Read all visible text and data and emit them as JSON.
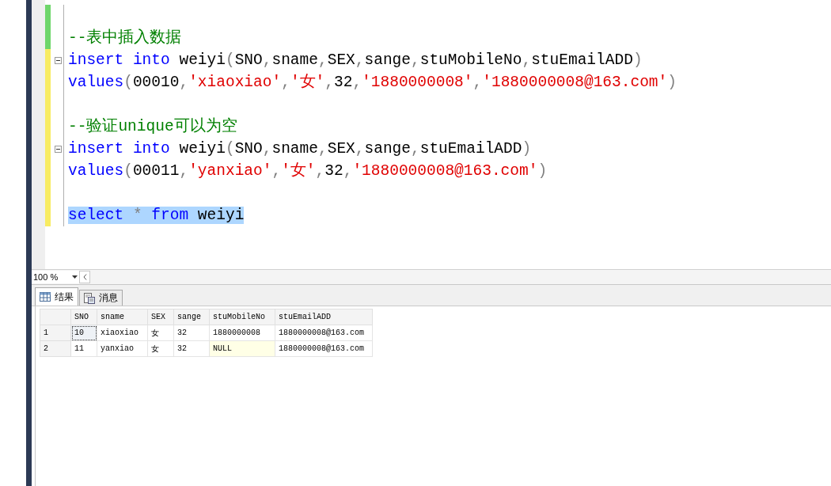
{
  "editor": {
    "lines": [
      {
        "saved": true,
        "fold": false
      },
      {
        "saved": true,
        "fold": false,
        "selected": false,
        "tokens": [
          {
            "kind": "comment",
            "text": "--表中插入数据"
          }
        ]
      },
      {
        "saved": false,
        "fold": true,
        "selected": false,
        "tokens": [
          {
            "kind": "keyword",
            "text": "insert"
          },
          {
            "kind": "keyword",
            "text": " into"
          },
          {
            "kind": "plain",
            "text": " weiyi"
          },
          {
            "kind": "punct",
            "text": "("
          },
          {
            "kind": "plain",
            "text": "SNO"
          },
          {
            "kind": "punct",
            "text": ","
          },
          {
            "kind": "plain",
            "text": "sname"
          },
          {
            "kind": "punct",
            "text": ","
          },
          {
            "kind": "plain",
            "text": "SEX"
          },
          {
            "kind": "punct",
            "text": ","
          },
          {
            "kind": "plain",
            "text": "sange"
          },
          {
            "kind": "punct",
            "text": ","
          },
          {
            "kind": "plain",
            "text": "stuMobileNo"
          },
          {
            "kind": "punct",
            "text": ","
          },
          {
            "kind": "plain",
            "text": "stuEmailADD"
          },
          {
            "kind": "punct",
            "text": ")"
          }
        ]
      },
      {
        "saved": false,
        "fold": false,
        "selected": false,
        "tokens": [
          {
            "kind": "keyword",
            "text": "values"
          },
          {
            "kind": "punct",
            "text": "("
          },
          {
            "kind": "plain",
            "text": "00010"
          },
          {
            "kind": "punct",
            "text": ","
          },
          {
            "kind": "string",
            "text": "'xiaoxiao'"
          },
          {
            "kind": "punct",
            "text": ","
          },
          {
            "kind": "string",
            "text": "'女'"
          },
          {
            "kind": "punct",
            "text": ","
          },
          {
            "kind": "plain",
            "text": "32"
          },
          {
            "kind": "punct",
            "text": ","
          },
          {
            "kind": "string",
            "text": "'1880000008'"
          },
          {
            "kind": "punct",
            "text": ","
          },
          {
            "kind": "string",
            "text": "'1880000008@163.com'"
          },
          {
            "kind": "punct",
            "text": ")"
          }
        ]
      },
      {
        "saved": false,
        "fold": false
      },
      {
        "saved": false,
        "fold": false,
        "selected": false,
        "tokens": [
          {
            "kind": "comment",
            "text": "--验证unique可以为空"
          }
        ]
      },
      {
        "saved": false,
        "fold": true,
        "selected": false,
        "tokens": [
          {
            "kind": "keyword",
            "text": "insert"
          },
          {
            "kind": "keyword",
            "text": " into"
          },
          {
            "kind": "plain",
            "text": " weiyi"
          },
          {
            "kind": "punct",
            "text": "("
          },
          {
            "kind": "plain",
            "text": "SNO"
          },
          {
            "kind": "punct",
            "text": ","
          },
          {
            "kind": "plain",
            "text": "sname"
          },
          {
            "kind": "punct",
            "text": ","
          },
          {
            "kind": "plain",
            "text": "SEX"
          },
          {
            "kind": "punct",
            "text": ","
          },
          {
            "kind": "plain",
            "text": "sange"
          },
          {
            "kind": "punct",
            "text": ","
          },
          {
            "kind": "plain",
            "text": "stuEmailADD"
          },
          {
            "kind": "punct",
            "text": ")"
          }
        ]
      },
      {
        "saved": false,
        "fold": false,
        "selected": false,
        "tokens": [
          {
            "kind": "keyword",
            "text": "values"
          },
          {
            "kind": "punct",
            "text": "("
          },
          {
            "kind": "plain",
            "text": "00011"
          },
          {
            "kind": "punct",
            "text": ","
          },
          {
            "kind": "string",
            "text": "'yanxiao'"
          },
          {
            "kind": "punct",
            "text": ","
          },
          {
            "kind": "string",
            "text": "'女'"
          },
          {
            "kind": "punct",
            "text": ","
          },
          {
            "kind": "plain",
            "text": "32"
          },
          {
            "kind": "punct",
            "text": ","
          },
          {
            "kind": "string",
            "text": "'1880000008@163.com'"
          },
          {
            "kind": "punct",
            "text": ")"
          }
        ]
      },
      {
        "saved": false,
        "fold": false
      },
      {
        "saved": false,
        "fold": false,
        "selected": true,
        "tokens": [
          {
            "kind": "keyword",
            "text": "select"
          },
          {
            "kind": "op",
            "text": " *"
          },
          {
            "kind": "keyword",
            "text": " from"
          },
          {
            "kind": "plain",
            "text": " weiyi"
          }
        ]
      }
    ]
  },
  "zoom": {
    "value": "100 %"
  },
  "tabs": [
    {
      "label": "结果",
      "kind": "grid",
      "selected": true
    },
    {
      "label": "消息",
      "kind": "messages",
      "selected": false
    }
  ],
  "results": {
    "columns": [
      "SNO",
      "sname",
      "SEX",
      "sange",
      "stuMobileNo",
      "stuEmailADD"
    ],
    "rows": [
      {
        "number": "1",
        "cells": [
          {
            "text": "10",
            "focused": true,
            "null": false
          },
          {
            "text": "xiaoxiao",
            "focused": false,
            "null": false
          },
          {
            "text": "女",
            "focused": false,
            "null": false
          },
          {
            "text": "32",
            "focused": false,
            "null": false
          },
          {
            "text": "1880000008",
            "focused": false,
            "null": false
          },
          {
            "text": "1880000008@163.com",
            "focused": false,
            "null": false
          }
        ]
      },
      {
        "number": "2",
        "cells": [
          {
            "text": "11",
            "focused": false,
            "null": false
          },
          {
            "text": "yanxiao",
            "focused": false,
            "null": false
          },
          {
            "text": "女",
            "focused": false,
            "null": false
          },
          {
            "text": "32",
            "focused": false,
            "null": false
          },
          {
            "text": "NULL",
            "focused": false,
            "null": true
          },
          {
            "text": "1880000008@163.com",
            "focused": false,
            "null": false
          }
        ]
      }
    ]
  }
}
